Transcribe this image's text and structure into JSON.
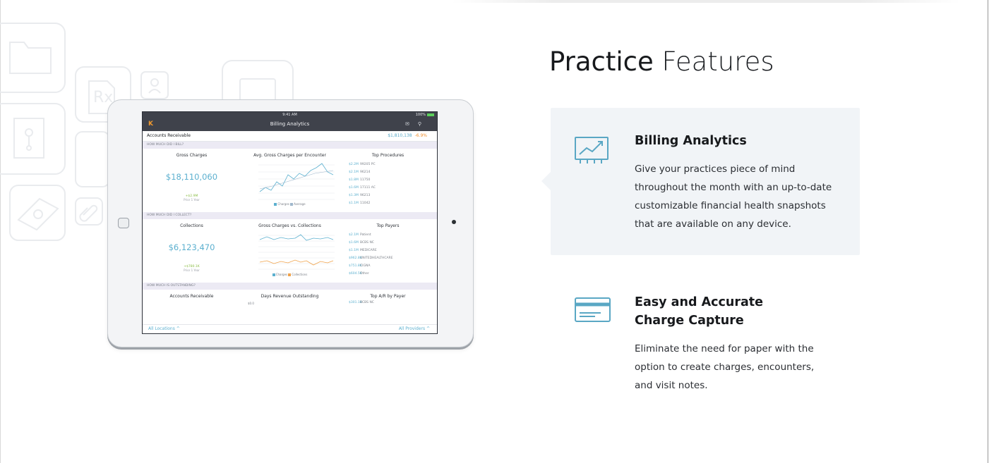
{
  "heading": {
    "strong": "Practice",
    "light": " Features"
  },
  "features": [
    {
      "title": "Billing Analytics",
      "description": "Give your practices piece of mind throughout the month with an up-to-date customizable financial health snapshots that are available on any device.",
      "icon": "line-chart-icon"
    },
    {
      "title_line1": "Easy and Accurate",
      "title_line2": "Charge Capture",
      "description": "Eliminate the need for paper with the option to create charges, encounters, and visit notes.",
      "icon": "credit-card-icon"
    }
  ],
  "colors": {
    "accent": "#5cb0cf",
    "card_bg": "#f1f4f7",
    "positive": "#8bbd45",
    "brand_orange": "#f29a2e"
  },
  "tablet": {
    "status_time": "9:41 AM",
    "status_battery": "100%",
    "nav_title": "Billing Analytics",
    "ar_label": "Accounts Receivable",
    "ar_amount": "$1,810,138",
    "ar_change": "-6.9%",
    "section1": "HOW MUCH DID I BILL?",
    "gross_charges_label": "Gross Charges",
    "gross_charges_value": "$18,110,060",
    "gross_charges_change": "+$2.9M",
    "gross_charges_period": "Prior 1 Year",
    "avg_label": "Avg. Gross Charges per Encounter",
    "avg_legend_1": "Charges",
    "avg_legend_2": "Average",
    "top_procedures_label": "Top Procedures",
    "top_procedures": [
      {
        "v": "$2.2M",
        "n": "99205 PC"
      },
      {
        "v": "$2.1M",
        "n": "96214"
      },
      {
        "v": "$1.8M",
        "n": "11750"
      },
      {
        "v": "$1.6M",
        "n": "17111 AC"
      },
      {
        "v": "$1.3M",
        "n": "96213"
      },
      {
        "v": "$1.1M",
        "n": "11042"
      }
    ],
    "section2": "HOW MUCH DID I COLLECT?",
    "collections_label": "Collections",
    "collections_value": "$6,123,470",
    "collections_change": "+$780.1K",
    "collections_period": "Prior 1 Year",
    "gvc_label": "Gross Charges vs. Collections",
    "gvc_legend_1": "Charges",
    "gvc_legend_2": "Collections",
    "top_payers_label": "Top Payers",
    "top_payers": [
      {
        "v": "$2.1M",
        "n": "Patient"
      },
      {
        "v": "$1.6M",
        "n": "BCBS NC"
      },
      {
        "v": "$1.1M",
        "n": "MEDICARE"
      },
      {
        "v": "$962.8K",
        "n": "UNITEDHEALTHCARE"
      },
      {
        "v": "$751.8K",
        "n": "CIGNA"
      },
      {
        "v": "$604.5K",
        "n": "Other"
      }
    ],
    "section3": "HOW MUCH IS OUTSTANDING?",
    "ar2_label": "Accounts Receivable",
    "dro_label": "Days Revenue Outstanding",
    "dro_tick": "$0.0",
    "top_ar_label": "Top A/R by Payer",
    "top_ar_first": {
      "v": "$301.1K",
      "n": "BCBS NC"
    },
    "footer_left": "All Locations ^",
    "footer_right": "All Providers ^"
  }
}
